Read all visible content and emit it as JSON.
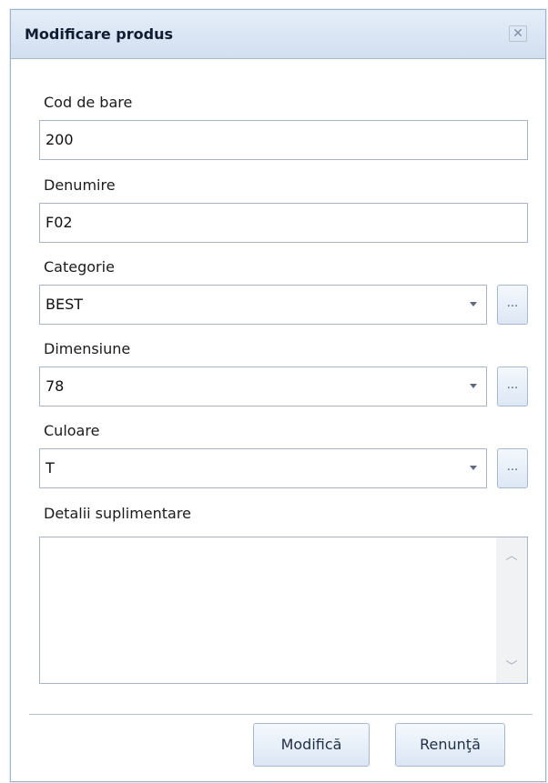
{
  "dialog": {
    "title": "Modificare produs",
    "close_icon": "close-icon"
  },
  "form": {
    "barcode": {
      "label": "Cod de bare",
      "value": "200"
    },
    "name": {
      "label": "Denumire",
      "value": "F02"
    },
    "category": {
      "label": "Categorie",
      "value": "BEST",
      "browse_label": "..."
    },
    "size": {
      "label": "Dimensiune",
      "value": "78",
      "browse_label": "..."
    },
    "color": {
      "label": "Culoare",
      "value": "T",
      "browse_label": "..."
    },
    "details": {
      "label": "Detalii suplimentare",
      "value": ""
    }
  },
  "buttons": {
    "modify_label": "Modifică",
    "cancel_label": "Renunţă"
  }
}
